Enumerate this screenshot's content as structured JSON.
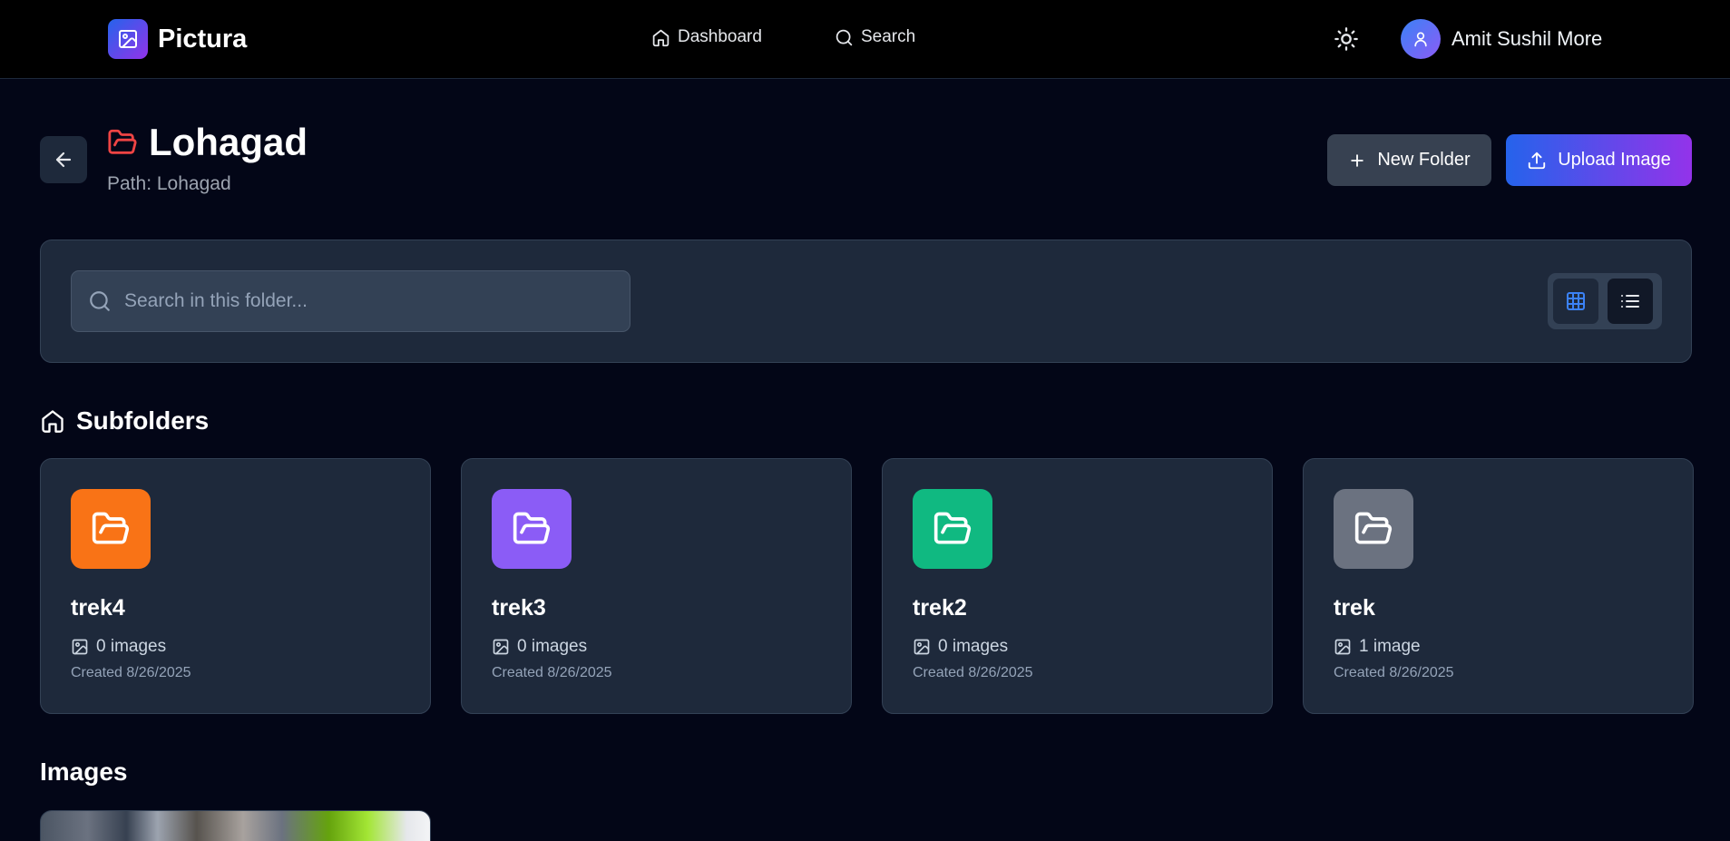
{
  "app": {
    "name": "Pictura"
  },
  "nav": {
    "dashboard": "Dashboard",
    "search": "Search"
  },
  "user": {
    "name": "Amit Sushil More"
  },
  "header": {
    "title": "Lohagad",
    "path": "Path: Lohagad"
  },
  "actions": {
    "new_folder": "New Folder",
    "upload_image": "Upload Image"
  },
  "search": {
    "placeholder": "Search in this folder...",
    "value": ""
  },
  "view": {
    "active": "grid"
  },
  "subfolders": {
    "title": "Subfolders",
    "items": [
      {
        "name": "trek4",
        "count": "0 images",
        "created": "Created 8/26/2025",
        "color": "#f97316"
      },
      {
        "name": "trek3",
        "count": "0 images",
        "created": "Created 8/26/2025",
        "color": "#8b5cf6"
      },
      {
        "name": "trek2",
        "count": "0 images",
        "created": "Created 8/26/2025",
        "color": "#10b981"
      },
      {
        "name": "trek",
        "count": "1 image",
        "created": "Created 8/26/2025",
        "color": "#6b7280"
      }
    ]
  },
  "images": {
    "title": "Images"
  },
  "colors": {
    "background": "#030617",
    "surface": "#1e293b",
    "accent_start": "#2563eb",
    "accent_end": "#9333ea",
    "folder_title_icon": "#ef4444"
  }
}
